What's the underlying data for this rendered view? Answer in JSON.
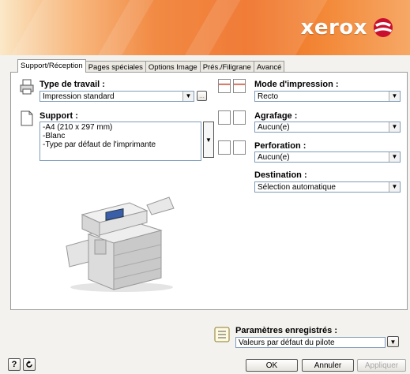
{
  "brand": {
    "logo_text": "xerox",
    "accent": "#ee6a1c"
  },
  "tabs": [
    {
      "label": "Support/Réception",
      "active": true
    },
    {
      "label": "Pages spéciales",
      "active": false
    },
    {
      "label": "Options Image",
      "active": false
    },
    {
      "label": "Prés./Filigrane",
      "active": false
    },
    {
      "label": "Avancé",
      "active": false
    }
  ],
  "job_type": {
    "label": "Type de travail :",
    "value": "Impression standard",
    "more_label": "..."
  },
  "paper": {
    "label": "Support :",
    "lines": [
      "-A4 (210 x 297 mm)",
      "-Blanc",
      "-Type par défaut de l'imprimante"
    ]
  },
  "print_mode": {
    "label": "Mode d'impression :",
    "value": "Recto"
  },
  "stapling": {
    "label": "Agrafage :",
    "value": "Aucun(e)"
  },
  "punching": {
    "label": "Perforation :",
    "value": "Aucun(e)"
  },
  "destination": {
    "label": "Destination :",
    "value": "Sélection automatique"
  },
  "saved_settings": {
    "label": "Paramètres enregistrés :",
    "value": "Valeurs par défaut du pilote"
  },
  "buttons": {
    "help": "?",
    "ok": "OK",
    "cancel": "Annuler",
    "apply": "Appliquer"
  }
}
